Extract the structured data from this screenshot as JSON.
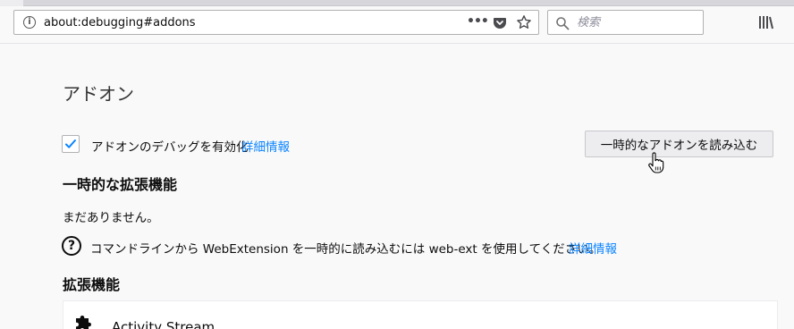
{
  "browser": {
    "url": "about:debugging#addons",
    "search_placeholder": "検索",
    "icons": {
      "info": "info-icon",
      "page_actions": "more-horizontal-icon",
      "pocket": "pocket-icon",
      "bookmark": "star-icon",
      "search": "search-icon",
      "library": "library-icon"
    }
  },
  "page": {
    "title": "アドオン",
    "enable_debugging": {
      "label": "アドオンのデバッグを有効化",
      "checked": true,
      "learn_more": "詳細情報"
    },
    "load_temp_button": "一時的なアドオンを読み込む",
    "temporary": {
      "heading": "一時的な拡張機能",
      "empty": "まだありません。",
      "tip": "コマンドラインから WebExtension を一時的に読み込むには web-ext を使用してください。",
      "tip_link": "詳細情報"
    },
    "extensions": {
      "heading": "拡張機能",
      "items": [
        {
          "name": "Activity Stream",
          "icon": "puzzle-piece-icon"
        }
      ]
    }
  },
  "colors": {
    "link": "#0a84ff",
    "checkmark": "#0a84ff",
    "background": "#f9f9fa",
    "button": "#ededf0"
  }
}
